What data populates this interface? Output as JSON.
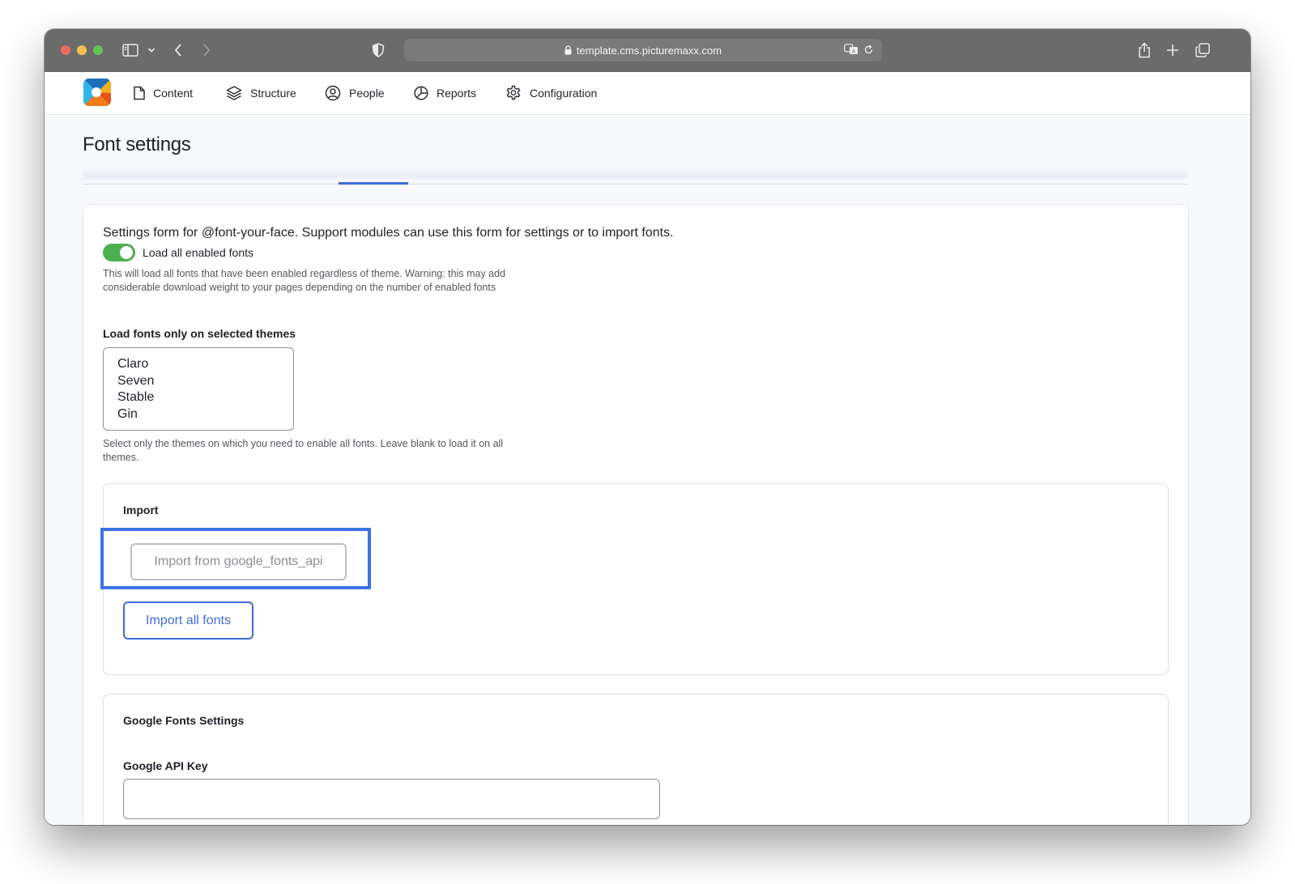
{
  "browser": {
    "url": "template.cms.picturemaxx.com"
  },
  "nav": {
    "items": [
      {
        "label": "Content",
        "icon": "file-icon"
      },
      {
        "label": "Structure",
        "icon": "layers-icon"
      },
      {
        "label": "People",
        "icon": "user-circle-icon"
      },
      {
        "label": "Reports",
        "icon": "pie-chart-icon"
      },
      {
        "label": "Configuration",
        "icon": "gear-icon"
      }
    ]
  },
  "page": {
    "title": "Font settings"
  },
  "form": {
    "description": "Settings form for @font-your-face. Support modules can use this form for settings or to import fonts.",
    "load_all": {
      "label": "Load all enabled fonts",
      "checked": true,
      "help": "This will load all fonts that have been enabled regardless of theme. Warning: this may add considerable download weight to your pages depending on the number of enabled fonts"
    },
    "themes": {
      "label": "Load fonts only on selected themes",
      "options": [
        "Claro",
        "Seven",
        "Stable",
        "Gin"
      ],
      "help": "Select only the themes on which you need to enable all fonts. Leave blank to load it on all themes."
    },
    "import": {
      "title": "Import",
      "import_google_label": "Import from google_fonts_api",
      "import_all_label": "Import all fonts"
    },
    "google": {
      "title": "Google Fonts Settings",
      "api_key_label": "Google API Key",
      "api_key_value": ""
    }
  },
  "colors": {
    "accent": "#3f6ad8",
    "toggle_on": "#4caf50",
    "highlight": "#3a73e6"
  }
}
